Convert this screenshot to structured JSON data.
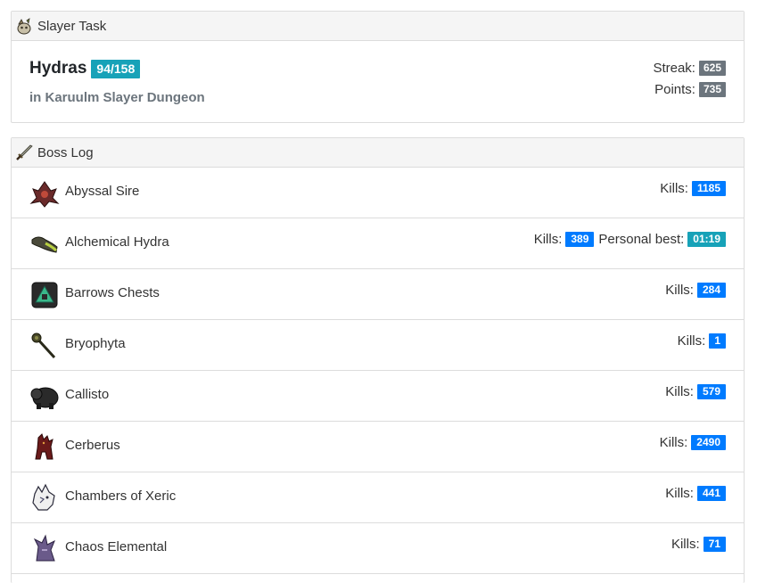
{
  "slayer": {
    "header": "Slayer Task",
    "header_icon": "slayer-helmet-icon",
    "task_name": "Hydras",
    "task_count": "94/158",
    "location": "in Karuulm Slayer Dungeon",
    "streak_label": "Streak:",
    "streak_value": "625",
    "points_label": "Points:",
    "points_value": "735"
  },
  "boss_log": {
    "header": "Boss Log",
    "header_icon": "sword-icon",
    "kills_label": "Kills:",
    "pb_label": "Personal best:",
    "rows": [
      {
        "name": "Abyssal Sire",
        "icon": "abyssal-sire-icon",
        "kills": "1185"
      },
      {
        "name": "Alchemical Hydra",
        "icon": "alchemical-hydra-icon",
        "kills": "389",
        "pb": "01:19"
      },
      {
        "name": "Barrows Chests",
        "icon": "barrows-chests-icon",
        "kills": "284"
      },
      {
        "name": "Bryophyta",
        "icon": "bryophyta-icon",
        "kills": "1"
      },
      {
        "name": "Callisto",
        "icon": "callisto-icon",
        "kills": "579"
      },
      {
        "name": "Cerberus",
        "icon": "cerberus-icon",
        "kills": "2490"
      },
      {
        "name": "Chambers of Xeric",
        "icon": "chambers-of-xeric-icon",
        "kills": "441"
      },
      {
        "name": "Chaos Elemental",
        "icon": "chaos-elemental-icon",
        "kills": "71"
      }
    ]
  },
  "colors": {
    "kills_badge": "#007bff",
    "info_badge": "#17a2b8",
    "gray_badge": "#6c757d"
  }
}
